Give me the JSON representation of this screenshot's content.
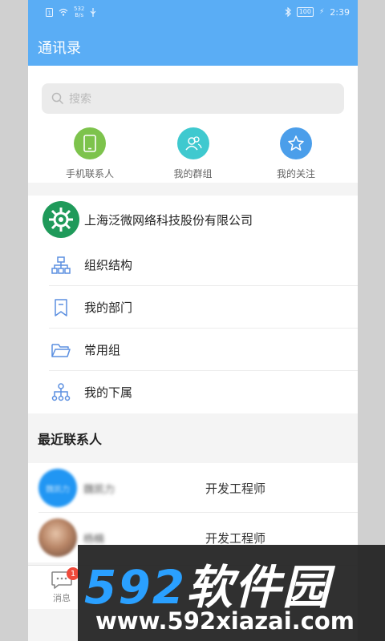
{
  "status_bar": {
    "net_speed_value": "532",
    "net_speed_unit": "B/s",
    "battery": "100",
    "time": "2:39"
  },
  "header": {
    "title": "通讯录"
  },
  "search": {
    "placeholder": "搜索"
  },
  "quick_links": [
    {
      "label": "手机联系人",
      "icon": "phone-icon",
      "color": "#7dc34c"
    },
    {
      "label": "我的群组",
      "icon": "group-icon",
      "color": "#3fc9cf"
    },
    {
      "label": "我的关注",
      "icon": "star-icon",
      "color": "#4b9eea"
    }
  ],
  "company": {
    "name": "上海泛微网络科技股份有限公司"
  },
  "menu": [
    {
      "label": "组织结构",
      "icon": "org-structure-icon"
    },
    {
      "label": "我的部门",
      "icon": "bookmark-icon"
    },
    {
      "label": "常用组",
      "icon": "folder-icon"
    },
    {
      "label": "我的下属",
      "icon": "subordinate-icon"
    }
  ],
  "recent": {
    "title": "最近联系人",
    "contacts": [
      {
        "avatar_text": "魏凯力",
        "name": "魏凯力",
        "role": "开发工程师"
      },
      {
        "avatar_text": "",
        "name": "杨楠",
        "role": "开发工程师"
      }
    ]
  },
  "tabbar": {
    "messages_label": "消息",
    "messages_badge": "1"
  },
  "watermark": {
    "brand_digits": "592",
    "brand_text": "软件园",
    "url": "www.592xiazai.com"
  },
  "colors": {
    "primary": "#5aadf5",
    "accent_icon": "#5b8fe0",
    "badge": "#f04a3b"
  }
}
